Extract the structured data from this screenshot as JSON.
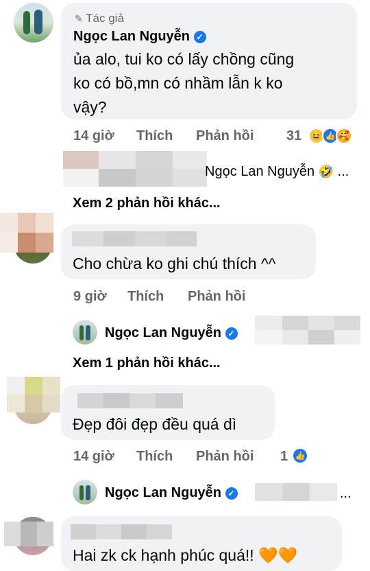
{
  "author_comment": {
    "badge": "Tác giả",
    "name": "Ngọc Lan Nguyễn",
    "text_lines": [
      "ủa alo, tui ko có lấy chồng cũng",
      "ko có bồ,mn có nhầm lẫn k ko",
      "vậy?"
    ],
    "time": "14 giờ",
    "like": "Thích",
    "reply": "Phản hồi",
    "reaction_count": "31",
    "reactions": [
      "haha-icon",
      "like-icon",
      "care-icon"
    ]
  },
  "reply_preview_1": {
    "name": "Ngọc Lan Nguyễn",
    "ellipsis": "..."
  },
  "view_more_1": "Xem 2 phản hồi khác...",
  "comment_2": {
    "text": "Cho chừa ko ghi chú thích ^^",
    "time": "9 giờ",
    "like": "Thích",
    "reply": "Phản hồi"
  },
  "reply_preview_2": {
    "name": "Ngọc Lan Nguyễn"
  },
  "view_more_2": "Xem 1 phản hồi khác...",
  "comment_3": {
    "text": "Đẹp đôi đẹp đều quá dì",
    "time": "14 giờ",
    "like": "Thích",
    "reply": "Phản hồi",
    "reaction_count": "1"
  },
  "reply_preview_3": {
    "name": "Ngọc Lan Nguyễn",
    "ellipsis": "..."
  },
  "comment_4": {
    "text": "Hai zk ck hạnh phúc quá!!"
  },
  "colors": {
    "verified": "#1877f2",
    "bubble": "#f0f2f5",
    "meta": "#65676b"
  }
}
